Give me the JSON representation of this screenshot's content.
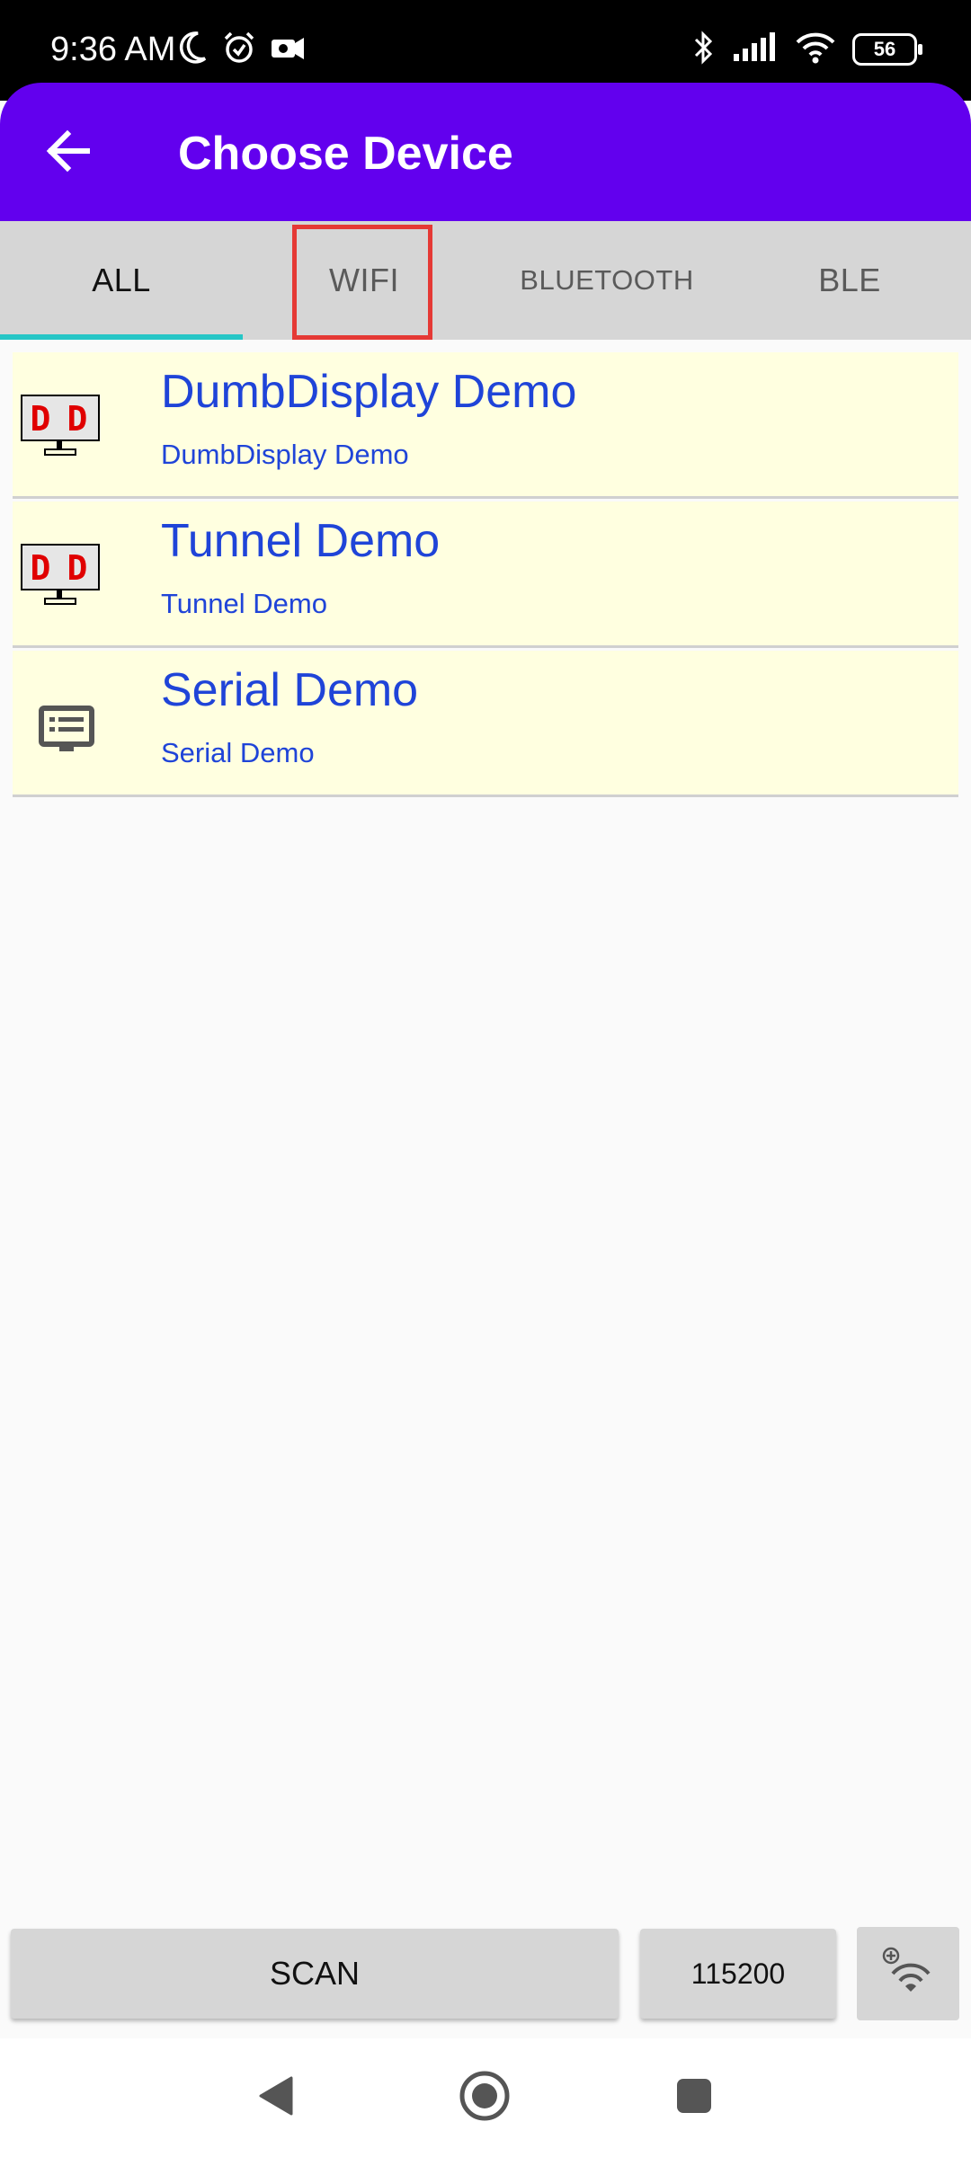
{
  "status_bar": {
    "time": "9:36 AM",
    "battery_level": "56",
    "icons": [
      "moon-icon",
      "alarm-icon",
      "notification-icon",
      "bluetooth-icon",
      "signal-icon",
      "wifi-icon",
      "battery-icon"
    ]
  },
  "app_bar": {
    "title": "Choose Device",
    "back_icon": "back-arrow-icon",
    "color": "#6200ee"
  },
  "tabs": [
    {
      "label": "ALL",
      "active": true
    },
    {
      "label": "WIFI",
      "active": false
    },
    {
      "label": "BLUETOOTH",
      "active": false
    },
    {
      "label": "BLE",
      "active": false
    }
  ],
  "devices": [
    {
      "name": "DumbDisplay Demo",
      "subtitle": "DumbDisplay Demo",
      "icon": "dd-display-icon"
    },
    {
      "name": "Tunnel Demo",
      "subtitle": "Tunnel Demo",
      "icon": "dd-display-icon"
    },
    {
      "name": "Serial Demo",
      "subtitle": "Serial Demo",
      "icon": "serial-monitor-icon"
    }
  ],
  "bottom": {
    "scan_label": "SCAN",
    "baud_label": "115200",
    "wifi_add_icon": "wifi-add-icon"
  },
  "colors": {
    "accent": "#26c6c6",
    "list_bg": "#ffffe0",
    "list_text": "#1f44d8",
    "highlight": "#e53935"
  }
}
